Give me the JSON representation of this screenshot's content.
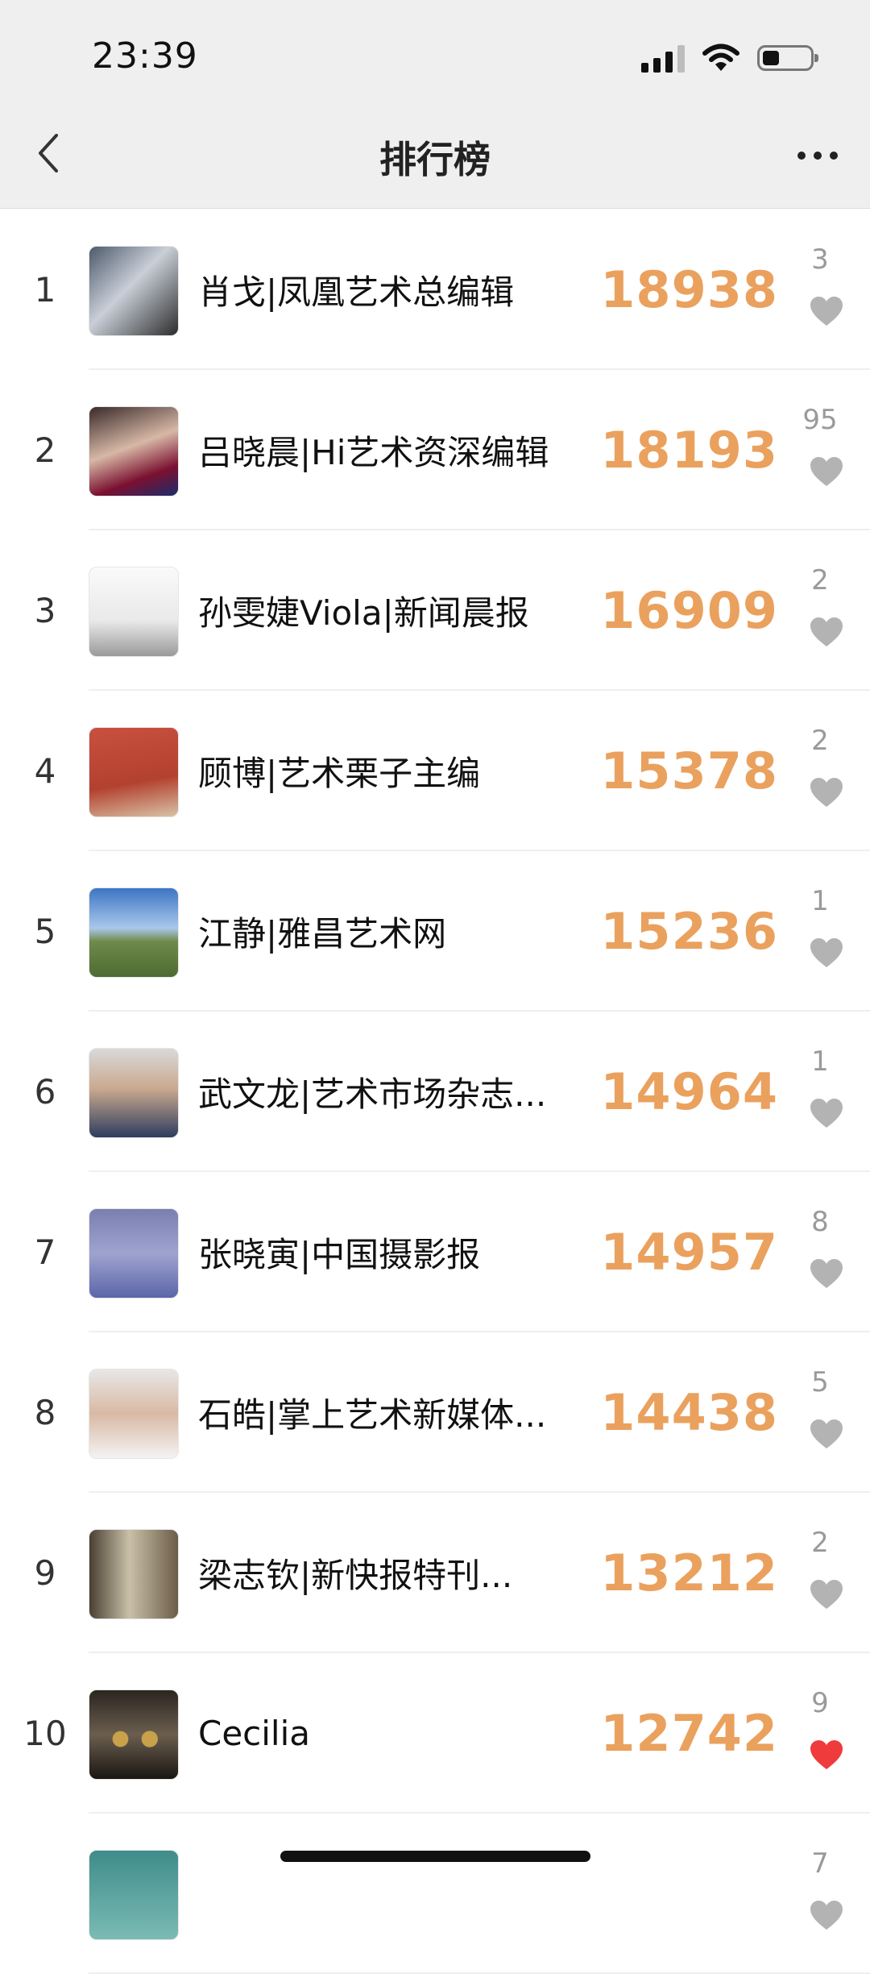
{
  "status_bar": {
    "time": "23:39"
  },
  "nav": {
    "title": "排行榜"
  },
  "colors": {
    "score": "#eaa15e",
    "heart_inactive": "#b3b3b3",
    "heart_active": "#ef3b3b"
  },
  "ranking": [
    {
      "rank": "1",
      "name": "肖戈|凤凰艺术总编辑",
      "score": "18938",
      "likes": "3",
      "liked": false
    },
    {
      "rank": "2",
      "name": "吕晓晨|Hi艺术资深编辑",
      "score": "18193",
      "likes": "95",
      "liked": false
    },
    {
      "rank": "3",
      "name": "孙雯婕Viola|新闻晨报",
      "score": "16909",
      "likes": "2",
      "liked": false
    },
    {
      "rank": "4",
      "name": "顾博|艺术栗子主编",
      "score": "15378",
      "likes": "2",
      "liked": false
    },
    {
      "rank": "5",
      "name": "江静|雅昌艺术网",
      "score": "15236",
      "likes": "1",
      "liked": false
    },
    {
      "rank": "6",
      "name": "武文龙|艺术市场杂志...",
      "score": "14964",
      "likes": "1",
      "liked": false
    },
    {
      "rank": "7",
      "name": "张晓寅|中国摄影报",
      "score": "14957",
      "likes": "8",
      "liked": false
    },
    {
      "rank": "8",
      "name": "石皓|掌上艺术新媒体...",
      "score": "14438",
      "likes": "5",
      "liked": false
    },
    {
      "rank": "9",
      "name": "梁志钦|新快报特刊...",
      "score": "13212",
      "likes": "2",
      "liked": false
    },
    {
      "rank": "10",
      "name": "Cecilia",
      "score": "12742",
      "likes": "9",
      "liked": true
    },
    {
      "rank": "",
      "name": "",
      "score": "",
      "likes": "7",
      "liked": false
    }
  ]
}
